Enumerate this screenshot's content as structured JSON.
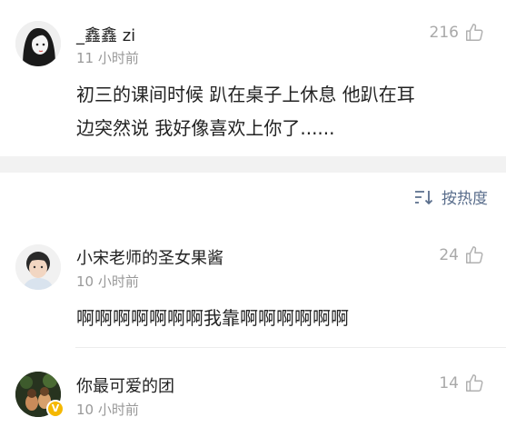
{
  "comments": [
    {
      "username": "_鑫鑫 zi",
      "time": "11 小时前",
      "likes": "216",
      "content_lines": [
        "初三的课间时候 趴在桌子上休息 他趴在耳",
        "边突然说 我好像喜欢上你了......"
      ]
    },
    {
      "username": "小宋老师的圣女果酱",
      "time": "10 小时前",
      "likes": "24",
      "content_lines": [
        "啊啊啊啊啊啊啊我靠啊啊啊啊啊啊"
      ]
    },
    {
      "username": "你最可爱的团",
      "time": "10 小时前",
      "likes": "14",
      "content_lines": []
    }
  ],
  "sort": {
    "label": "按热度"
  },
  "icons": {
    "like": "thumbs-up-icon",
    "sort": "sort-icon",
    "verified": "verified-badge-icon"
  },
  "colors": {
    "accent": "#5a6e8c",
    "muted": "#999999",
    "vip": "#f5b800"
  }
}
